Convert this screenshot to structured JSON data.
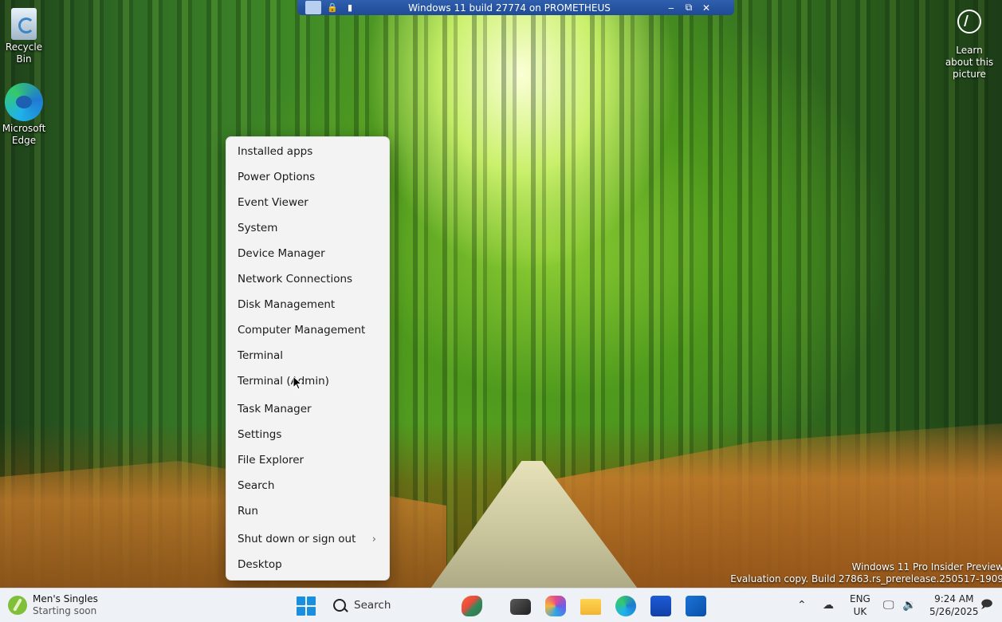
{
  "remote_bar": {
    "title": "Windows 11 build 27774 on PROMETHEUS",
    "minimize": "‒",
    "restore": "⧉",
    "close": "✕"
  },
  "desktop": {
    "icons": [
      {
        "label": "Recycle Bin"
      },
      {
        "label": "Microsoft Edge"
      }
    ],
    "learn_about": "Learn about this picture",
    "watermark_line1": "Windows 11 Pro Insider Preview",
    "watermark_line2": "Evaluation copy. Build 27863.rs_prerelease.250517-1909"
  },
  "context_menu": {
    "items": [
      {
        "label": "Installed apps"
      },
      {
        "label": "Power Options"
      },
      {
        "label": "Event Viewer"
      },
      {
        "label": "System"
      },
      {
        "label": "Device Manager"
      },
      {
        "label": "Network Connections"
      },
      {
        "label": "Disk Management"
      },
      {
        "label": "Computer Management"
      },
      {
        "label": "Terminal"
      },
      {
        "label": "Terminal (Admin)"
      },
      {
        "label": "Task Manager"
      },
      {
        "label": "Settings"
      },
      {
        "label": "File Explorer"
      },
      {
        "label": "Search"
      },
      {
        "label": "Run"
      },
      {
        "label": "Shut down or sign out",
        "submenu": true
      },
      {
        "label": "Desktop"
      }
    ],
    "submenu_glyph": "›"
  },
  "taskbar": {
    "widget_title": "Men's Singles",
    "widget_sub": "Starting soon",
    "search_label": "Search",
    "apps": [
      "copilot-app",
      "snipping-tool",
      "microsoft-365",
      "file-explorer",
      "microsoft-edge",
      "microsoft-store",
      "outlook"
    ],
    "language_top": "ENG",
    "language_bottom": "UK",
    "time": "9:24 AM",
    "date": "5/26/2025",
    "colors": {
      "accent": "#1a8fe0",
      "taskbar_bg": "#eef1f5",
      "menu_bg": "#f3f3f3"
    }
  }
}
